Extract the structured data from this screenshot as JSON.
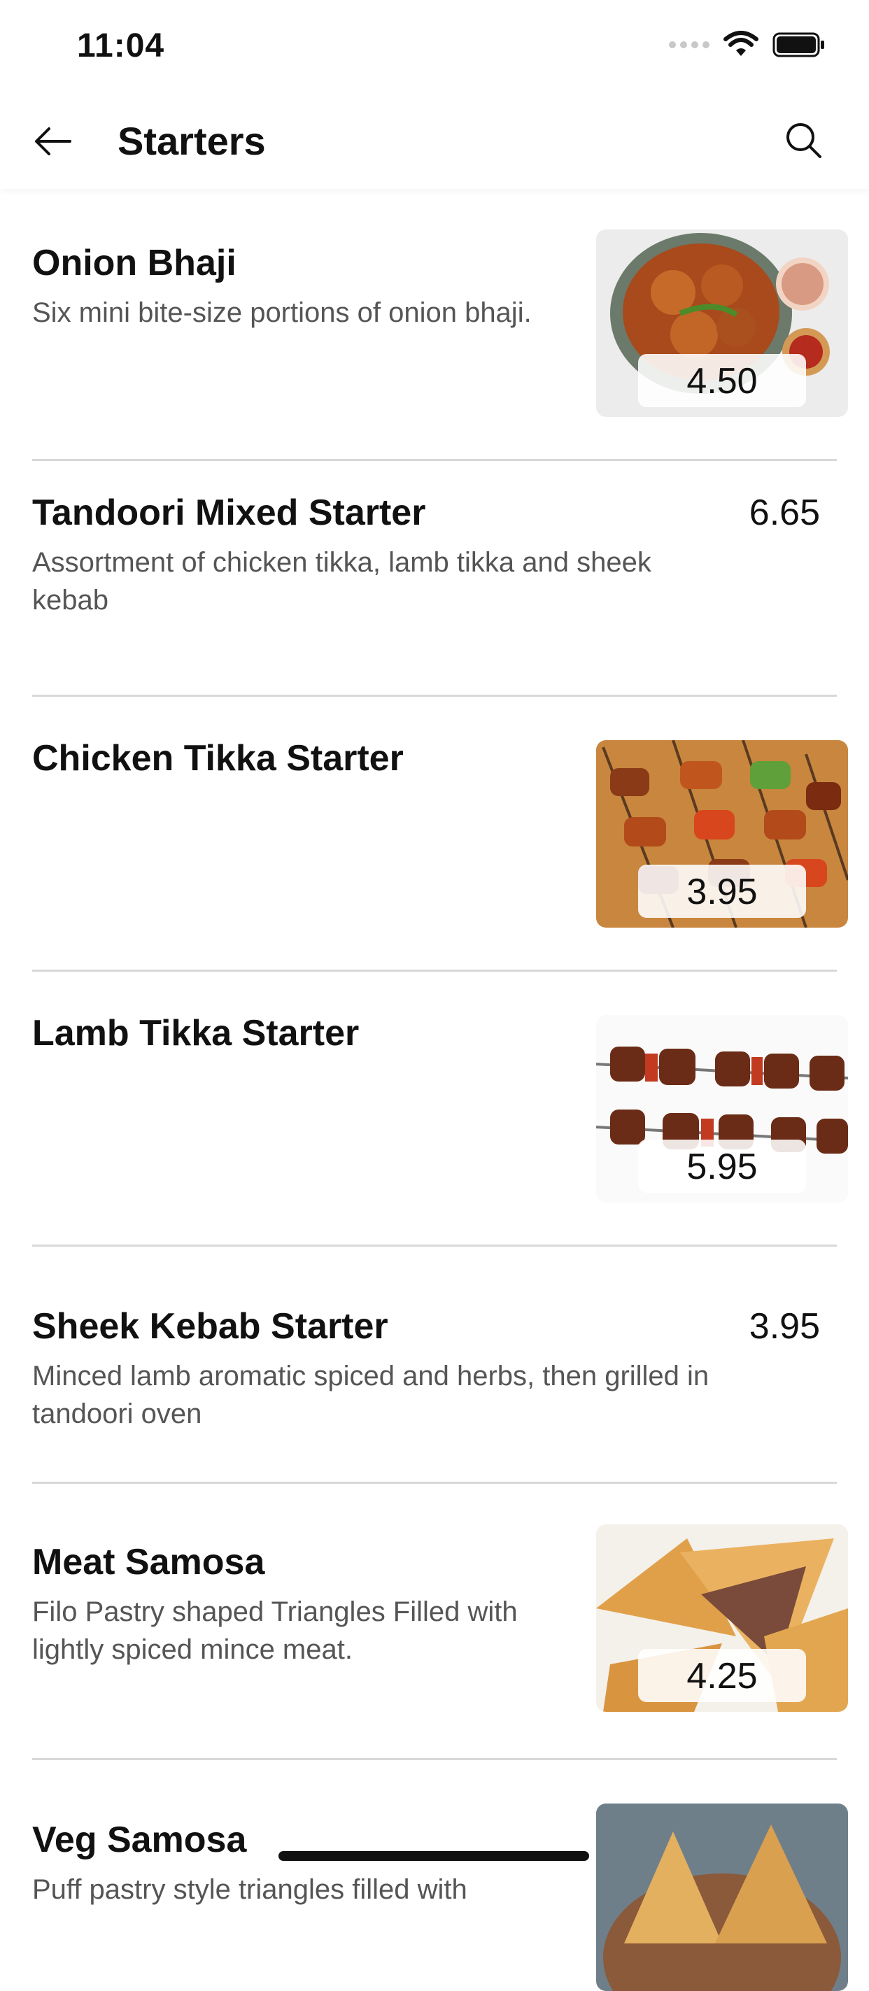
{
  "status": {
    "time": "11:04"
  },
  "header": {
    "title": "Starters"
  },
  "items": [
    {
      "title": "Onion Bhaji",
      "desc": "Six mini bite-size portions of onion bhaji.",
      "price": "4.50",
      "has_image": true,
      "image": "onion-bhaji-photo"
    },
    {
      "title": "Tandoori Mixed Starter",
      "desc": "Assortment of chicken tikka, lamb tikka and sheek kebab",
      "price": "6.65",
      "has_image": false
    },
    {
      "title": "Chicken Tikka Starter",
      "desc": "",
      "price": "3.95",
      "has_image": true,
      "image": "chicken-tikka-photo"
    },
    {
      "title": "Lamb Tikka Starter",
      "desc": "",
      "price": "5.95",
      "has_image": true,
      "image": "lamb-tikka-photo"
    },
    {
      "title": "Sheek Kebab Starter",
      "desc": "Minced lamb aromatic spiced and herbs, then grilled in tandoori oven",
      "price": "3.95",
      "has_image": false
    },
    {
      "title": "Meat Samosa",
      "desc": "Filo Pastry shaped Triangles Filled with lightly spiced mince meat.",
      "price": "4.25",
      "has_image": true,
      "image": "meat-samosa-photo"
    },
    {
      "title": "Veg Samosa",
      "desc": "Puff pastry style triangles filled with",
      "price": "",
      "has_image": true,
      "image": "veg-samosa-photo"
    }
  ],
  "icons": [
    "back-arrow-icon",
    "search-icon",
    "wifi-icon",
    "battery-icon",
    "signal-icon"
  ]
}
